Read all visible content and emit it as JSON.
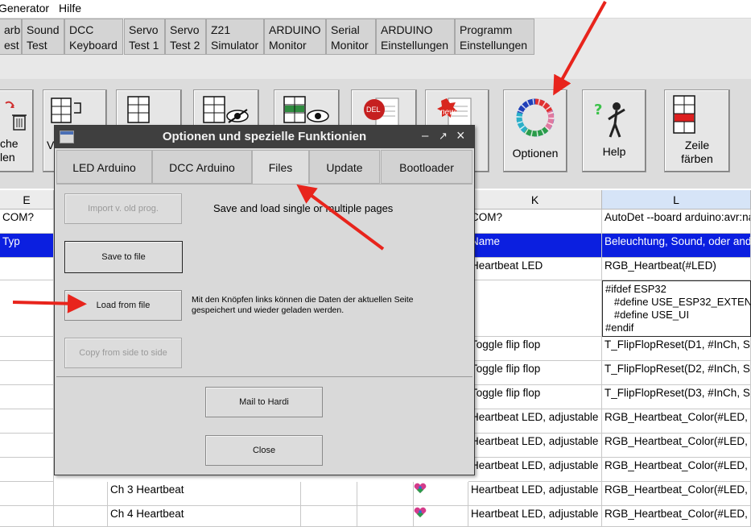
{
  "menu": {
    "items": [
      "Generator",
      "Hilfe"
    ]
  },
  "ribbon_tabs": [
    {
      "label": "arb\nest"
    },
    {
      "label": "Sound\nTest"
    },
    {
      "label": "DCC\nKeyboard"
    },
    {
      "label": "Servo\nTest 1"
    },
    {
      "label": "Servo\nTest 2"
    },
    {
      "label": "Z21\nSimulator"
    },
    {
      "label": "ARDUINO\nMonitor"
    },
    {
      "label": "Serial\nMonitor"
    },
    {
      "label": "ARDUINO\nEinstellungen"
    },
    {
      "label": "Programm\nEinstellungen"
    }
  ],
  "toolbar": {
    "partial_left_label": "che\nlen",
    "partial_v_label": "V",
    "options_label": "Optionen",
    "help_label": "Help",
    "color_row_label": "Zeile\nfärben",
    "del_badge": "DEL",
    "new_badge": "new"
  },
  "sheet": {
    "columns": {
      "e": "E",
      "k": "K",
      "l": "L"
    },
    "rows": [
      {
        "e": "COM?",
        "k": "COM?",
        "l": "AutoDet --board arduino:avr:nan"
      },
      {
        "e": "Typ",
        "k": "Name",
        "l": "Beleuchtung, Sound, oder ande"
      },
      {
        "e": "",
        "k": "Heartbeat LED",
        "l": "RGB_Heartbeat(#LED)"
      },
      {
        "e": "",
        "k": "",
        "l": "#ifdef ESP32\n   #define USE_ESP32_EXTEN\n   #define USE_UI\n#endif"
      },
      {
        "e": "",
        "k": "Toggle flip flop",
        "l": "T_FlipFlopReset(D1, #InCh, SI_"
      },
      {
        "e": "",
        "k": "Toggle flip flop",
        "l": "T_FlipFlopReset(D2, #InCh, SI_"
      },
      {
        "e": "",
        "k": "Toggle flip flop",
        "l": "T_FlipFlopReset(D3, #InCh, SI_"
      },
      {
        "e": "",
        "k": "Heartbeat LED, adjustable",
        "l": "RGB_Heartbeat_Color(#LED, 5"
      },
      {
        "e": "",
        "k": "Heartbeat LED, adjustable",
        "l": "RGB_Heartbeat_Color(#LED, 5"
      },
      {
        "e": "",
        "k": "Heartbeat LED, adjustable",
        "l": "RGB_Heartbeat_Color(#LED, 5"
      },
      {
        "e": "",
        "c": "Ch 3 Heartbeat",
        "k": "Heartbeat LED, adjustable",
        "l": "RGB_Heartbeat_Color(#LED, 5"
      },
      {
        "e": "",
        "c": "Ch 4 Heartbeat",
        "k": "Heartbeat LED, adjustable",
        "l": "RGB_Heartbeat_Color(#LED, 5"
      }
    ]
  },
  "dialog": {
    "title": "Optionen und spezielle Funktionien",
    "controls": {
      "minimize": "–",
      "restore": "↗",
      "close": "×"
    },
    "tabs": [
      "LED Arduino",
      "DCC Arduino",
      "Files",
      "Update",
      "Bootloader"
    ],
    "active_tab": "Files",
    "heading": "Save and load single or multiple pages",
    "description": "Mit den Knöpfen links können die Daten der aktuellen Seite\ngespeichert und wieder geladen werden.",
    "buttons": {
      "import_old": "Import v. old prog.",
      "save_to_file": "Save to file",
      "load_from_file": "Load from file",
      "copy_side": "Copy from side to side",
      "mail": "Mail to Hardi",
      "close": "Close"
    }
  },
  "colors": {
    "selected_row": "#0b1fe0",
    "arrow": "#e8241c",
    "dialog_title_bg": "#3f3f3f"
  }
}
